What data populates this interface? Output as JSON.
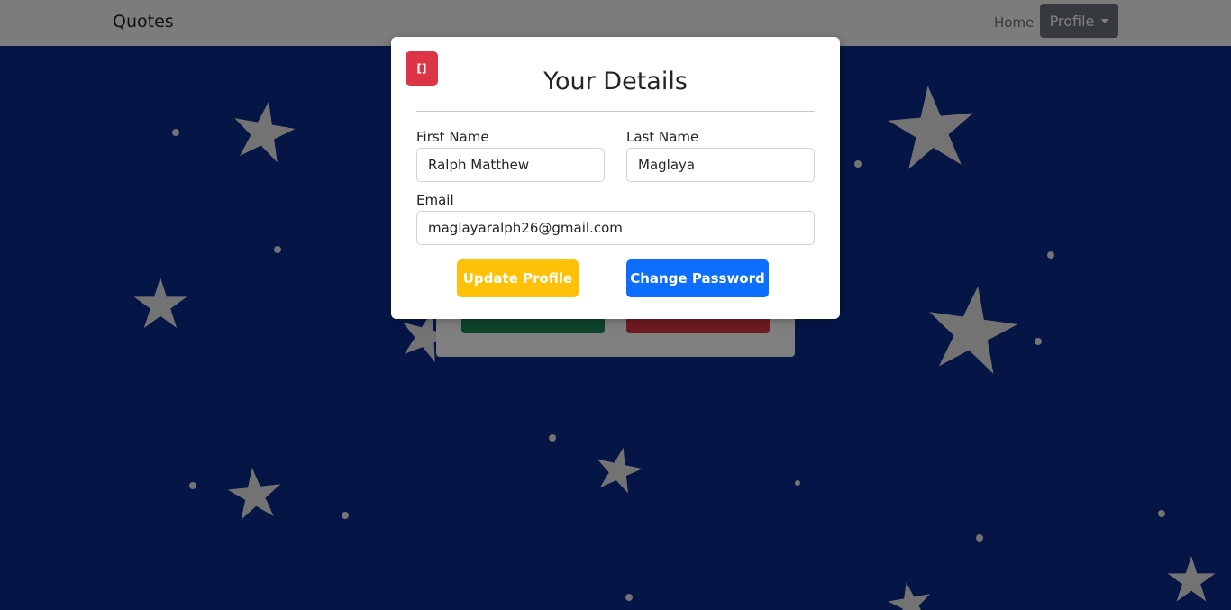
{
  "navbar": {
    "brand": "Quotes",
    "home_label": "Home",
    "profile_label": "Profile"
  },
  "modal": {
    "close_label": "[]",
    "title": "Your Details",
    "fields": {
      "first_name_label": "First Name",
      "first_name_value": "Ralph Matthew",
      "last_name_label": "Last Name",
      "last_name_value": "Maglaya",
      "email_label": "Email",
      "email_value": "maglayaralph26@gmail.com"
    },
    "update_profile_label": "Update Profile",
    "change_password_label": "Change Password"
  },
  "colors": {
    "background": "#0a2a8a",
    "close_button": "#dc3545",
    "update_profile_button": "#ffc107",
    "change_password_button": "#0d6efd",
    "background_card_button_left": "#198754",
    "background_card_button_right": "#dc3545",
    "profile_nav_button": "#6c757d"
  },
  "background_icons": [
    "star-icon"
  ]
}
